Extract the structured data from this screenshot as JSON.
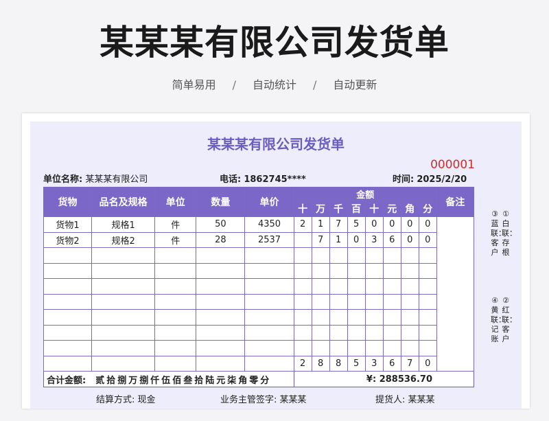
{
  "header": {
    "title": "某某某有限公司发货单",
    "subtitle": [
      "简单易用",
      "自动统计",
      "自动更新"
    ],
    "separator": "/"
  },
  "form": {
    "title": "某某某有限公司发货单",
    "serial": "000001",
    "unit_label": "单位名称:",
    "unit_value": "某某某有限公司",
    "phone_label": "电话:",
    "phone_value": "1862745****",
    "time_label": "时间:",
    "time_value": "2025/2/20"
  },
  "table": {
    "headers": {
      "goods": "货物",
      "spec": "品名及规格",
      "unit": "单位",
      "qty": "数量",
      "price": "单价",
      "amount": "金额",
      "remark": "备注"
    },
    "digit_headers": [
      "十",
      "万",
      "千",
      "百",
      "十",
      "元",
      "角",
      "分"
    ],
    "rows": [
      {
        "goods": "货物1",
        "spec": "规格1",
        "unit": "件",
        "qty": "50",
        "price": "4350",
        "digits": [
          "2",
          "1",
          "7",
          "5",
          "0",
          "0",
          "0",
          "0"
        ]
      },
      {
        "goods": "货物2",
        "spec": "规格2",
        "unit": "件",
        "qty": "28",
        "price": "2537",
        "digits": [
          "",
          "7",
          "1",
          "0",
          "3",
          "6",
          "0",
          "0"
        ]
      },
      {
        "goods": "",
        "spec": "",
        "unit": "",
        "qty": "",
        "price": "",
        "digits": [
          "",
          "",
          "",
          "",
          "",
          "",
          "",
          ""
        ]
      },
      {
        "goods": "",
        "spec": "",
        "unit": "",
        "qty": "",
        "price": "",
        "digits": [
          "",
          "",
          "",
          "",
          "",
          "",
          "",
          ""
        ]
      },
      {
        "goods": "",
        "spec": "",
        "unit": "",
        "qty": "",
        "price": "",
        "digits": [
          "",
          "",
          "",
          "",
          "",
          "",
          "",
          ""
        ]
      },
      {
        "goods": "",
        "spec": "",
        "unit": "",
        "qty": "",
        "price": "",
        "digits": [
          "",
          "",
          "",
          "",
          "",
          "",
          "",
          ""
        ]
      },
      {
        "goods": "",
        "spec": "",
        "unit": "",
        "qty": "",
        "price": "",
        "digits": [
          "",
          "",
          "",
          "",
          "",
          "",
          "",
          ""
        ]
      },
      {
        "goods": "",
        "spec": "",
        "unit": "",
        "qty": "",
        "price": "",
        "digits": [
          "",
          "",
          "",
          "",
          "",
          "",
          "",
          ""
        ]
      },
      {
        "goods": "",
        "spec": "",
        "unit": "",
        "qty": "",
        "price": "",
        "digits": [
          "",
          "",
          "",
          "",
          "",
          "",
          "",
          ""
        ]
      }
    ],
    "sum_digits": [
      "2",
      "8",
      "8",
      "5",
      "3",
      "6",
      "7",
      "0"
    ],
    "total_label": "合计金额:",
    "total_chinese": "贰拾捌万捌仟伍佰叁拾陆元柒角零分",
    "total_amount": "¥: 288536.70"
  },
  "side_labels": [
    "③蓝联：客户",
    "①白联：存根",
    "④黄联：记账",
    "②红联：客户"
  ],
  "footer": {
    "settlement_label": "结算方式:",
    "settlement_value": "现金",
    "supervisor_label": "业务主管签字:",
    "supervisor_value": "某某某",
    "receiver_label": "提货人:",
    "receiver_value": "某某某"
  }
}
